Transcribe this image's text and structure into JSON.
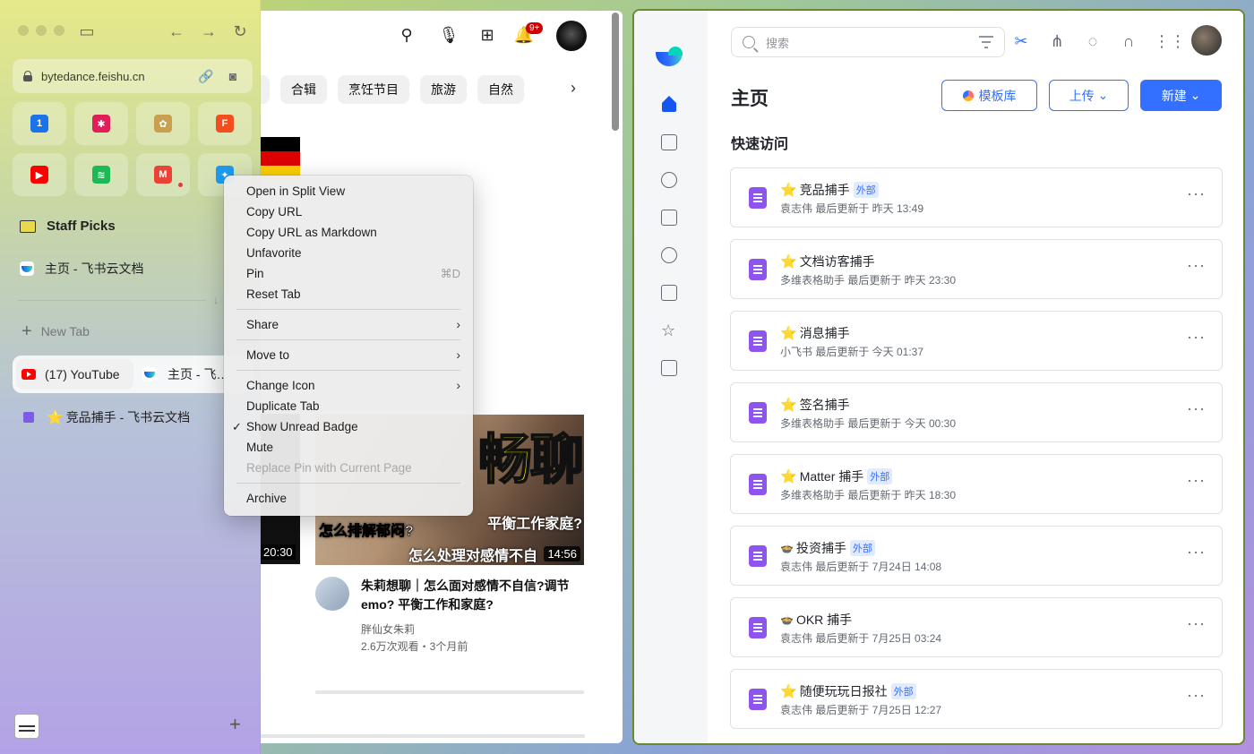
{
  "sidebar": {
    "url": "bytedance.feishu.cn",
    "folder_label": "Staff Picks",
    "pinned_tab_label": "主页 - 飞书云文档",
    "new_tab_label": "New Tab",
    "split_tab": {
      "left_label": "(17) YouTube",
      "right_label": "主页 - 飞…"
    },
    "tab_label": "竞品捕手 - 飞书云文档",
    "favorites": [
      {
        "icon": "google-calendar-icon",
        "glyph": "1",
        "color": "#1a73e8"
      },
      {
        "icon": "slack-icon",
        "glyph": "✱",
        "color": "#e01e5a"
      },
      {
        "icon": "photos-icon",
        "glyph": "✿",
        "color": "#c8a050"
      },
      {
        "icon": "figma-icon",
        "glyph": "F",
        "color": "#f24e1e"
      },
      {
        "icon": "youtube-icon",
        "glyph": "▶",
        "color": "#ff0000"
      },
      {
        "icon": "spotify-icon",
        "glyph": "≋",
        "color": "#1db954"
      },
      {
        "icon": "gmail-icon",
        "glyph": "M",
        "color": "#ea4335"
      },
      {
        "icon": "twitter-icon",
        "glyph": "✦",
        "color": "#1d9bf0"
      }
    ]
  },
  "youtube": {
    "notification_badge": "9+",
    "chips": [
      "合辑",
      "烹饪节目",
      "旅游",
      "自然"
    ],
    "left_video_duration": "20:30",
    "video": {
      "thumb_big_text": "畅聊",
      "thumb_caption_1": "怎么排解郁闷?",
      "thumb_caption_2": "平衡工作家庭?",
      "thumb_caption_3": "怎么处理对感情不自",
      "duration": "14:56",
      "title": "朱莉想聊｜怎么面对感情不自信?调节emo? 平衡工作和家庭?",
      "channel": "胖仙女朱莉",
      "meta": "2.6万次观看・3个月前"
    }
  },
  "context_menu": {
    "items": [
      {
        "label": "Open in Split View"
      },
      {
        "label": "Copy URL"
      },
      {
        "label": "Copy URL as Markdown"
      },
      {
        "label": "Unfavorite"
      },
      {
        "label": "Pin",
        "shortcut": "⌘D"
      },
      {
        "label": "Reset Tab"
      },
      {
        "label": "Share"
      },
      {
        "label": "Move to"
      },
      {
        "label": "Change Icon"
      },
      {
        "label": "Duplicate Tab"
      },
      {
        "label": "Show Unread Badge",
        "checked": true
      },
      {
        "label": "Mute"
      },
      {
        "label": "Replace Pin with Current Page",
        "disabled": true
      },
      {
        "label": "Archive"
      }
    ]
  },
  "feishu": {
    "search_placeholder": "搜索",
    "page_title": "主页",
    "template_button": "模板库",
    "upload_button": "上传",
    "new_button": "新建",
    "quick_access_title": "快速访问",
    "external_tag": "外部",
    "cards": [
      {
        "emoji": "⭐",
        "title": "竞品捕手",
        "external": true,
        "owner": "袁志伟",
        "updated": "最后更新于 昨天 13:49"
      },
      {
        "emoji": "⭐",
        "title": "文档访客捕手",
        "external": false,
        "owner": "多维表格助手",
        "updated": "最后更新于 昨天 23:30"
      },
      {
        "emoji": "⭐",
        "title": "消息捕手",
        "external": false,
        "owner": "小飞书",
        "updated": "最后更新于 今天 01:37"
      },
      {
        "emoji": "⭐",
        "title": "签名捕手",
        "external": false,
        "owner": "多维表格助手",
        "updated": "最后更新于 今天 00:30"
      },
      {
        "emoji": "⭐",
        "title": "Matter 捕手",
        "external": true,
        "owner": "多维表格助手",
        "updated": "最后更新于 昨天 18:30"
      },
      {
        "emoji": "🍲",
        "title": "投资捕手",
        "external": true,
        "owner": "袁志伟",
        "updated": "最后更新于 7月24日 14:08"
      },
      {
        "emoji": "🍲",
        "title": "OKR 捕手",
        "external": false,
        "owner": "袁志伟",
        "updated": "最后更新于 7月25日 03:24"
      },
      {
        "emoji": "⭐",
        "title": "随便玩玩日报社",
        "external": true,
        "owner": "袁志伟",
        "updated": "最后更新于 7月25日 12:27"
      }
    ]
  }
}
